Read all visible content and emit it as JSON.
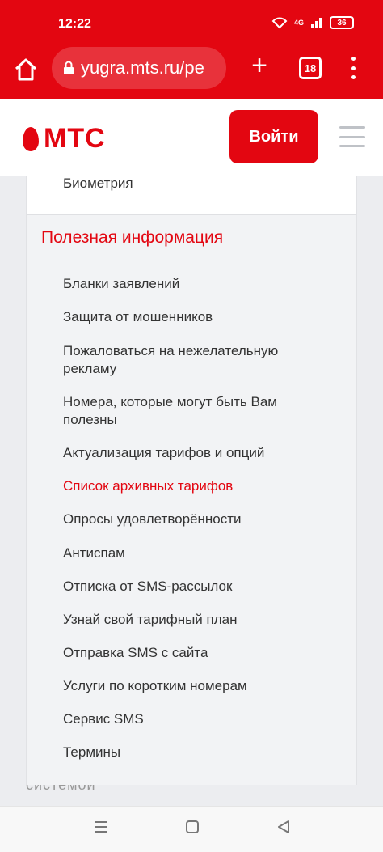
{
  "status": {
    "time": "12:22",
    "network": "4G",
    "battery": "36"
  },
  "browser": {
    "url": "yugra.mts.ru/pe",
    "tab_count": "18"
  },
  "header": {
    "logo_text": "МТС",
    "login_label": "Войти"
  },
  "menu": {
    "top_item": "Биометрия",
    "section_title": "Полезная информация",
    "items": [
      {
        "label": "Бланки заявлений"
      },
      {
        "label": "Защита от мошенников"
      },
      {
        "label": "Пожаловаться на нежелательную рекламу"
      },
      {
        "label": "Номера, которые могут быть Вам полезны"
      },
      {
        "label": "Актуализация тарифов и опций"
      },
      {
        "label": "Список архивных тарифов"
      },
      {
        "label": "Опросы удовлетворённости"
      },
      {
        "label": "Антиспам"
      },
      {
        "label": "Отписка от SMS-рассылок"
      },
      {
        "label": "Узнай свой тарифный план"
      },
      {
        "label": "Отправка SMS с сайта"
      },
      {
        "label": "Услуги по коротким номерам"
      },
      {
        "label": "Сервис SMS"
      },
      {
        "label": "Термины"
      }
    ],
    "active_index": 5
  },
  "behind_text": "системой",
  "colors": {
    "brand": "#e30611",
    "text": "#333333",
    "panel": "#f2f3f5"
  }
}
